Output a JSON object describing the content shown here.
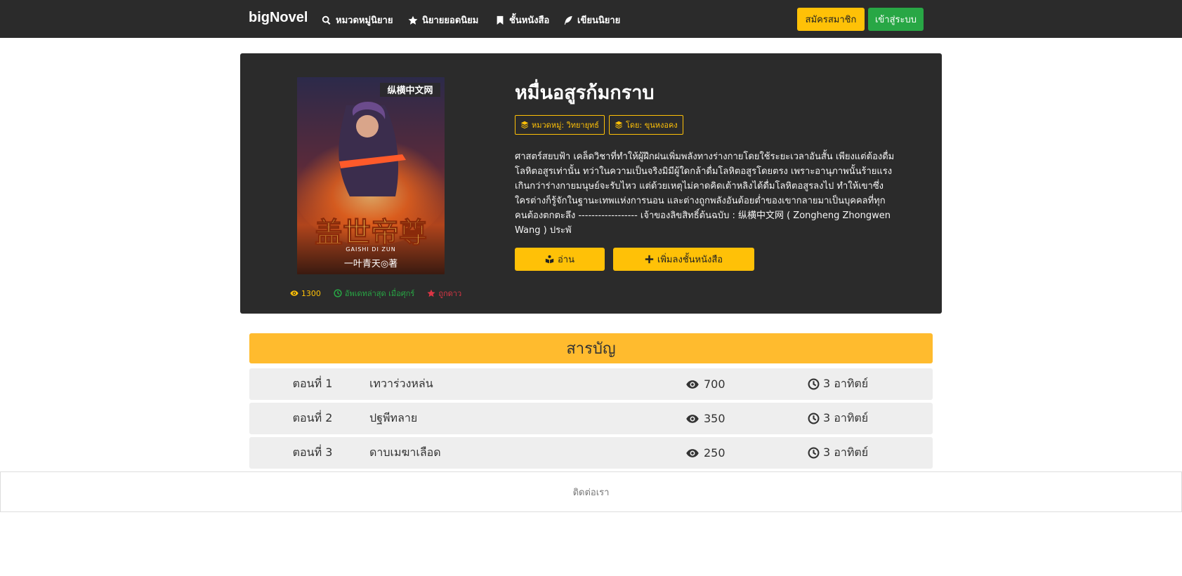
{
  "navbar": {
    "brand": "bigNovel",
    "items": [
      {
        "label": "หมวดหมู่นิยาย",
        "icon": "search-icon"
      },
      {
        "label": "นิยายยอดนิยม",
        "icon": "star-icon"
      },
      {
        "label": "ชั้นหนังสือ",
        "icon": "bookmark-icon"
      },
      {
        "label": "เขียนนิยาย",
        "icon": "feather-icon"
      }
    ],
    "register_label": "สมัครสมาชิก",
    "login_label": "เข้าสู่ระบบ"
  },
  "novel": {
    "title": "หมื่นอสูรก้มกราบ",
    "category_badge": "หมวดหมู่: วิทยายุทธ์",
    "author_badge": "โดย: ขุนหงอคง",
    "synopsis": "ศาสตร์สยบฟ้า เคล็ดวิชาที่ทำให้ผู้ฝึกฝนเพิ่มพลังทางร่างกายโดยใช้ระยะเวลาอันสั้น เพียงแต่ต้องดื่มโลหิตอสูรเท่านั้น ทว่าในความเป็นจริงมิมีผู้ใดกล้าดื่มโลหิตอสูรโดยตรง เพราะอานุภาพนั้นร้ายแรงเกินกว่าร่างกายมนุษย์จะรับไหว แต่ด้วยเหตุไม่คาดคิดเต้าหลิงได้ดื่มโลหิตอสูรลงไป ทำให้เขาซึ่งใครต่างก็รู้จักในฐานะเทพแห่งการนอน และต่างถูกพลังอันต้อยต่ำของเขากลายมาเป็นบุคคลที่ทุกคนต้องตกตะลึง ------------------ เจ้าของลิขสิทธิ์ต้นฉบับ : 纵横中文网 ( Zongheng Zhongwen Wang ) ประพั",
    "read_label": "อ่าน",
    "add_shelf_label": "เพิ่มลงชั้นหนังสือ",
    "views": "1300",
    "updated": "อัพเดทล่าสุด เมื่อศุกร์",
    "favorite": "ถูกดาว",
    "cover": {
      "publisher_mark": "纵横中文网",
      "title_calligraphy": "盖世帝尊",
      "romanized": "GAISHI DI ZUN",
      "author_line": "一叶青天◎著"
    }
  },
  "toc": {
    "header": "สารบัญ",
    "chapters": [
      {
        "number": "ตอนที่ 1",
        "title": "เทวาร่วงหล่น",
        "views": "700",
        "time": "3 อาทิตย์"
      },
      {
        "number": "ตอนที่ 2",
        "title": "ปฐพีทลาย",
        "views": "350",
        "time": "3 อาทิตย์"
      },
      {
        "number": "ตอนที่ 3",
        "title": "ดาบเมฆาเลือด",
        "views": "250",
        "time": "3 อาทิตย์"
      }
    ]
  },
  "footer": {
    "contact": "ติดต่อเรา"
  },
  "colors": {
    "navbar_bg": "#2b2b2b",
    "accent_yellow": "#ffc107",
    "toc_header": "#ffbb2e",
    "login_green": "#28a745",
    "favorite_red": "#dc3545"
  }
}
